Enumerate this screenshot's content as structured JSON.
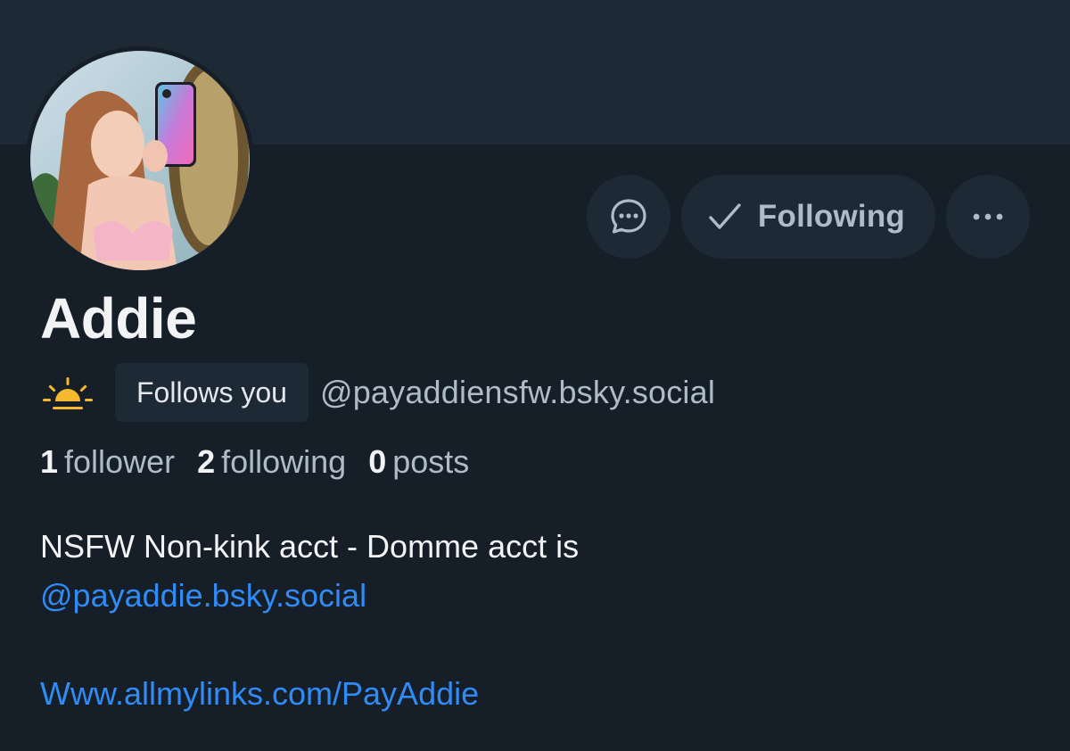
{
  "colors": {
    "background": "#161e27",
    "banner": "#1e2936",
    "button_bg": "#1e2936",
    "muted_text": "#aebbc9",
    "primary_text": "#f1f3f5",
    "link": "#2f8bf5",
    "sun_icon": "#f5b82e"
  },
  "profile": {
    "display_name": "Addie",
    "follows_you_label": "Follows you",
    "handle": "@payaddiensfw.bsky.social",
    "status_icon": "sunrise-icon"
  },
  "actions": {
    "message_icon": "chat-bubble-icon",
    "following_icon": "check-icon",
    "following_label": "Following",
    "more_icon": "ellipsis-icon"
  },
  "stats": {
    "followers_count": "1",
    "followers_label": "follower",
    "following_count": "2",
    "following_label": "following",
    "posts_count": "0",
    "posts_label": "posts"
  },
  "bio": {
    "line1": "NSFW Non-kink acct - Domme acct is",
    "mention_link": "@payaddie.bsky.social",
    "website_link": "Www.allmylinks.com/PayAddie"
  }
}
